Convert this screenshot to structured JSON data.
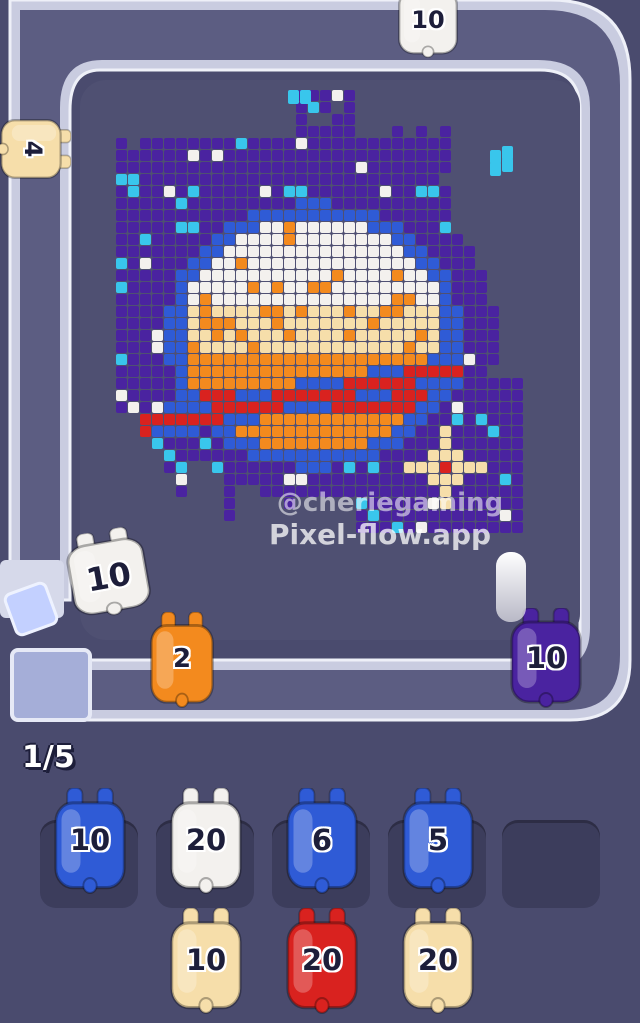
{
  "title": "",
  "level_progress": "1/5",
  "watermark": {
    "line1": "@cheriegaming",
    "line2": "Pixel-flow.app"
  },
  "colors": {
    "background": "#4a4b6e",
    "board": "#4f5072",
    "track": "#c9cce0",
    "purple": "#4a23a0",
    "blue": "#2f5bd6",
    "white": "#f3f1ee",
    "cream": "#f6deaa",
    "orange": "#f38a1e",
    "red": "#d9221f",
    "cyan": "#39c6ec"
  },
  "track_pieces": [
    {
      "id": "top-piece",
      "count": "10",
      "color": "white"
    },
    {
      "id": "left-piece",
      "count": "4",
      "color": "cream"
    },
    {
      "id": "fist-piece",
      "count": "10",
      "color": "white"
    },
    {
      "id": "belt-orange",
      "count": "2",
      "color": "orange"
    },
    {
      "id": "belt-purple",
      "count": "10",
      "color": "purple"
    }
  ],
  "queue_row1": [
    {
      "count": "10",
      "color": "blue"
    },
    {
      "count": "20",
      "color": "white"
    },
    {
      "count": "6",
      "color": "blue"
    },
    {
      "count": "5",
      "color": "blue"
    },
    {
      "count": "",
      "color": "empty"
    }
  ],
  "queue_row2": [
    {
      "count": "10",
      "color": "cream"
    },
    {
      "count": "20",
      "color": "red"
    },
    {
      "count": "20",
      "color": "cream"
    }
  ]
}
